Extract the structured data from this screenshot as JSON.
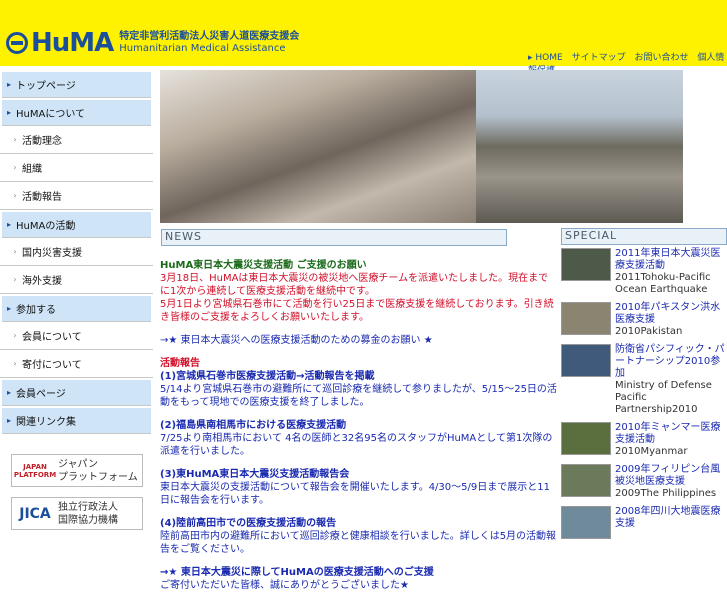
{
  "header": {
    "logo_word": "HuMA",
    "org_jp": "特定非営利活動法人災害人道医療支援会",
    "org_en": "Humanitarian Medical Assistance",
    "topnav": [
      "▸ HOME",
      "サイトマップ",
      "お問い合わせ",
      "個人情報保護"
    ]
  },
  "sidebar": {
    "items": [
      {
        "label": "トップページ",
        "type": "main"
      },
      {
        "label": "HuMAについて",
        "type": "main"
      },
      {
        "label": "活動理念",
        "type": "sub"
      },
      {
        "label": "組織",
        "type": "sub"
      },
      {
        "label": "活動報告",
        "type": "sub"
      },
      {
        "label": "HuMAの活動",
        "type": "main"
      },
      {
        "label": "国内災害支援",
        "type": "sub"
      },
      {
        "label": "海外支援",
        "type": "sub"
      },
      {
        "label": "参加する",
        "type": "main"
      },
      {
        "label": "会員について",
        "type": "sub"
      },
      {
        "label": "寄付について",
        "type": "sub"
      },
      {
        "label": "会員ページ",
        "type": "main"
      },
      {
        "label": "関連リンク集",
        "type": "main"
      }
    ],
    "banners": [
      {
        "mark": "JAPAN PLATFORM",
        "line1": "ジャパン",
        "line2": "プラットフォーム"
      },
      {
        "mark": "JICA",
        "line1": "独立行政法人",
        "line2": "国際協力機構"
      }
    ]
  },
  "news": {
    "header": "NEWS",
    "title": "HuMA東日本大震災支援活動 ご支援のお願い",
    "red_line1": "3月18日、HuMAは東日本大震災の被災地へ医療チームを派遣いたしました。現在までに1次から連続して医療支援活動を継続中です。",
    "red_line2": "5月1日より宮城県石巻市にて活動を行い25日まで医療支援を継続しております。引き続き皆様のご支援をよろしくお願いいたします。",
    "link": "→★ 東日本大震災への医療支援活動のための募金のお願い ★",
    "section": "活動報告",
    "items": [
      {
        "head": "(1)宮城県石巻市医療支援活動→活動報告を掲載",
        "body": "5/14より宮城県石巻市の避難所にて巡回診療を継続して参りましたが、5/15〜25日の活動をもって現地での医療支援を終了しました。"
      },
      {
        "head": "(2)福島県南相馬市における医療支援活動",
        "body": "7/25より南相馬市において 4名の医師と32名95名のスタッフがHuMAとして第1次隊の派遣を行いました。"
      },
      {
        "head": "(3)東HuMA東日本大震災支援活動報告会",
        "body": "東日本大震災の支援活動について報告会を開催いたします。4/30〜5/9日まで展示と11日に報告会を行います。"
      },
      {
        "head": "(4)陸前高田市での医療支援活動の報告",
        "body": "陸前高田市内の避難所において巡回診療と健康相談を行いました。詳しくは5月の活動報告をご覧ください。"
      }
    ],
    "tail_link": "→★ 東日本大震災に際してHuMAの医療支援活動へのご支援",
    "tail_link2": "ご寄付いただいた皆様、誠にありがとうございました★"
  },
  "special": {
    "header": "SPECIAL",
    "items": [
      {
        "link": "2011年東日本大震災医療支援活動",
        "sub": "2011Tohoku-Pacific Ocean Earthquake",
        "color": "#4d5a4a"
      },
      {
        "link": "2010年パキスタン洪水医療支援",
        "sub": "2010Pakistan",
        "color": "#8a8470"
      },
      {
        "link": "防衛省パシフィック・パートナーシップ2010参加",
        "sub": "Ministry of Defense Pacific Partnership2010",
        "color": "#3f5a7a"
      },
      {
        "link": "2010年ミャンマー医療支援活動",
        "sub": "2010Myanmar",
        "color": "#5a6e3e"
      },
      {
        "link": "2009年フィリピン台風被災地医療支援",
        "sub": "2009The Philippines",
        "color": "#6b7a5a"
      },
      {
        "link": "2008年四川大地震医療支援",
        "sub": "",
        "color": "#6f8a9a"
      }
    ]
  }
}
